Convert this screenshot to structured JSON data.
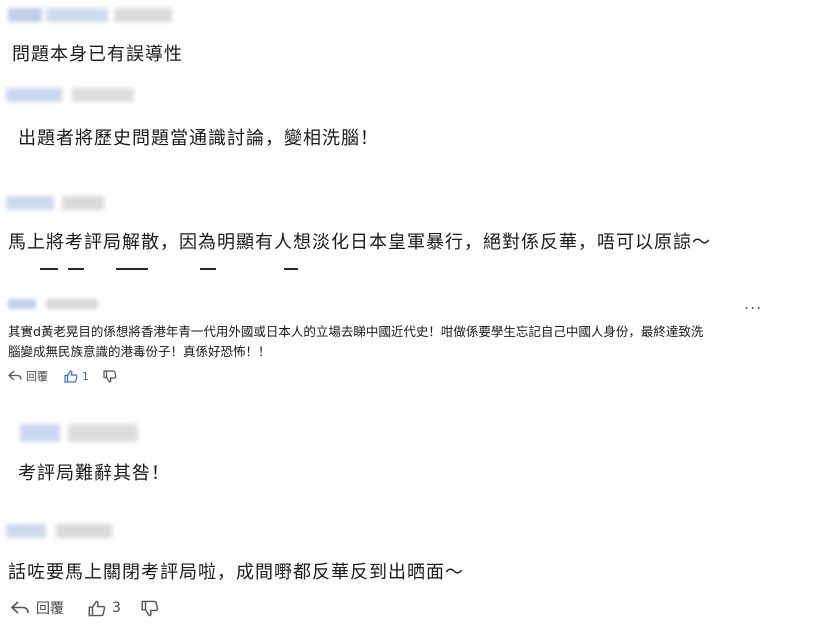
{
  "comments": [
    {
      "text": "問題本身已有誤導性"
    },
    {
      "text": "出題者將歷史問題當通識討論，變相洗腦！"
    },
    {
      "text": "馬上將考評局解散，因為明顯有人想淡化日本皇軍暴行，絕對係反華，唔可以原諒～"
    },
    {
      "text_line1": "其實d黃老晃目的係想將香港年青一代用外國或日本人的立場去睇中國近代史！咁做係要學生忘記自己中國人身份，最終達致洗",
      "text_line2": "腦變成無民族意識的港毒份子！真係好恐怖！！",
      "reply_label": "回覆",
      "like_count": "1",
      "more_label": "..."
    },
    {
      "text": "考評局難辭其咎！"
    },
    {
      "text": "話咗要馬上關閉考評局啦，成間嘢都反華反到出晒面～",
      "reply_label": "回覆",
      "like_count": "3"
    }
  ]
}
